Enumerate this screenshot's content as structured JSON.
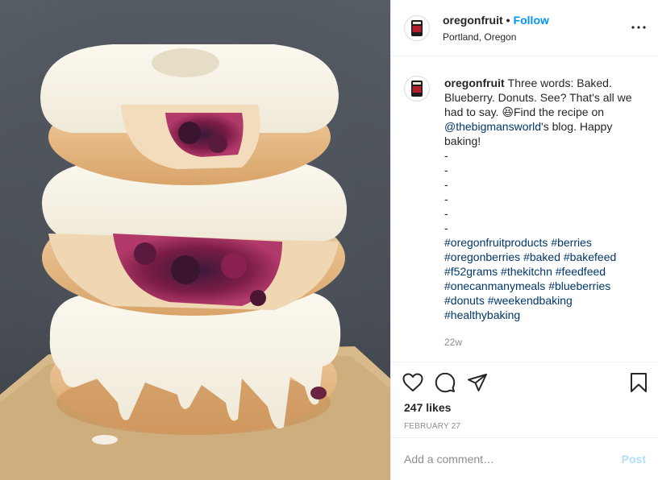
{
  "post": {
    "username": "oregonfruit",
    "follow_label": "Follow",
    "separator": "•",
    "location": "Portland, Oregon",
    "more_label": "•••",
    "caption": {
      "username": "oregonfruit",
      "text_1": "Three words: Baked. Blueberry. Donuts. See? That's all we had to say. ",
      "emoji": "😆",
      "text_2": "Find the recipe on ",
      "mention": "@thebigmansworld",
      "text_3": "'s blog. Happy baking!",
      "dashes": [
        "-",
        "-",
        "-",
        "-",
        "-",
        "-"
      ],
      "hashtags": [
        "#oregonfruitproducts",
        "#berries",
        "#oregonberries",
        "#baked",
        "#bakefeed",
        "#f52grams",
        "#thekitchn",
        "#feedfeed",
        "#onecanmanymeals",
        "#blueberries",
        "#donuts",
        "#weekendbaking",
        "#healthybaking"
      ]
    },
    "time_ago": "22w",
    "likes": "247 likes",
    "date": "FEBRUARY 27",
    "comment_placeholder": "Add a comment…",
    "post_button": "Post"
  },
  "icons": {
    "like": "heart-icon",
    "comment": "comment-bubble-icon",
    "share": "paper-plane-icon",
    "save": "bookmark-icon",
    "more": "more-options-icon"
  },
  "colors": {
    "link_blue": "#0095f6",
    "hashtag_navy": "#00376b",
    "muted_gray": "#8e8e8e",
    "post_disabled": "#b2dffc"
  }
}
